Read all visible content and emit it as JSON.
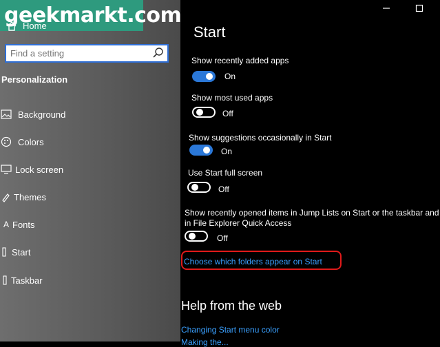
{
  "watermark": {
    "text": "geekmarkt.com"
  },
  "sidebar": {
    "home_label": "Home",
    "search": {
      "placeholder": "Find a setting",
      "value": ""
    },
    "section_title": "Personalization",
    "items": [
      {
        "label": "Background",
        "icon": "picture-icon"
      },
      {
        "label": "Colors",
        "icon": "palette-icon"
      },
      {
        "label": "Lock screen",
        "icon": "monitor-icon"
      },
      {
        "label": "Themes",
        "icon": "brush-icon"
      },
      {
        "label": "Fonts",
        "icon": "font-icon"
      },
      {
        "label": "Start",
        "icon": "start-icon"
      },
      {
        "label": "Taskbar",
        "icon": "taskbar-icon"
      }
    ]
  },
  "window": {
    "minimize_icon": "minimize-icon",
    "maximize_icon": "maximize-icon"
  },
  "main": {
    "title": "Start",
    "settings": [
      {
        "label": "Show recently added apps",
        "state": "On"
      },
      {
        "label": "Show most used apps",
        "state": "Off"
      },
      {
        "label": "Show suggestions occasionally in Start",
        "state": "On"
      },
      {
        "label": "Use Start full screen",
        "state": "Off"
      },
      {
        "label": "Show recently opened items in Jump Lists on Start or the taskbar and in File Explorer Quick Access",
        "state": "Off"
      }
    ],
    "link": "Choose which folders appear on Start",
    "help_title": "Help from the web",
    "help_links": [
      "Changing Start menu color",
      "Making the..."
    ]
  },
  "colors": {
    "accent": "#2b78d8",
    "link": "#3aa0ff",
    "highlight": "#e01a1a",
    "watermark_bg": "#2e9a7e"
  }
}
